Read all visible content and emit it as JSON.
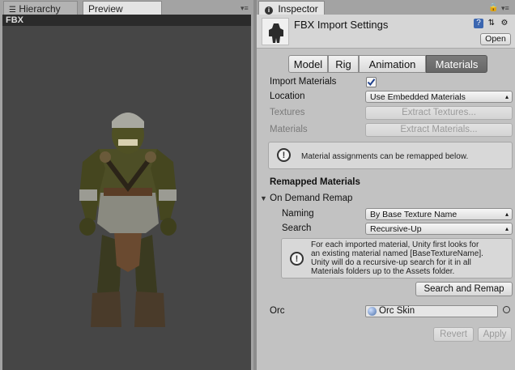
{
  "left_tabs": {
    "hierarchy_label": "Hierarchy",
    "preview_label": "Preview"
  },
  "preview": {
    "header": "FBX"
  },
  "inspector": {
    "tab_label": "Inspector",
    "title": "FBX Import Settings",
    "open_button": "Open",
    "tabs": [
      "Model",
      "Rig",
      "Animation",
      "Materials"
    ],
    "active_tab": "Materials",
    "import_materials_label": "Import Materials",
    "import_materials_checked": true,
    "location_label": "Location",
    "location_value": "Use Embedded Materials",
    "textures_label": "Textures",
    "extract_textures_button": "Extract Textures...",
    "materials_label": "Materials",
    "extract_materials_button": "Extract Materials...",
    "help1": "Material assignments can be remapped below.",
    "remapped_heading": "Remapped Materials",
    "on_demand_label": "On Demand Remap",
    "naming_label": "Naming",
    "naming_value": "By Base Texture Name",
    "search_label": "Search",
    "search_value": "Recursive-Up",
    "help2_lines": [
      "For each imported material, Unity first looks for",
      "an existing material named [BaseTextureName].",
      "Unity will do a recursive-up search for it in all",
      "Materials folders up to the Assets folder."
    ],
    "search_remap_button": "Search and Remap",
    "orc_label": "Orc",
    "orc_value": "Orc Skin",
    "revert_button": "Revert",
    "apply_button": "Apply"
  },
  "colors": {
    "active_tab": "#6e6e6e",
    "viewport_bg": "#464646",
    "checkbox_check": "#1d3f8c"
  }
}
